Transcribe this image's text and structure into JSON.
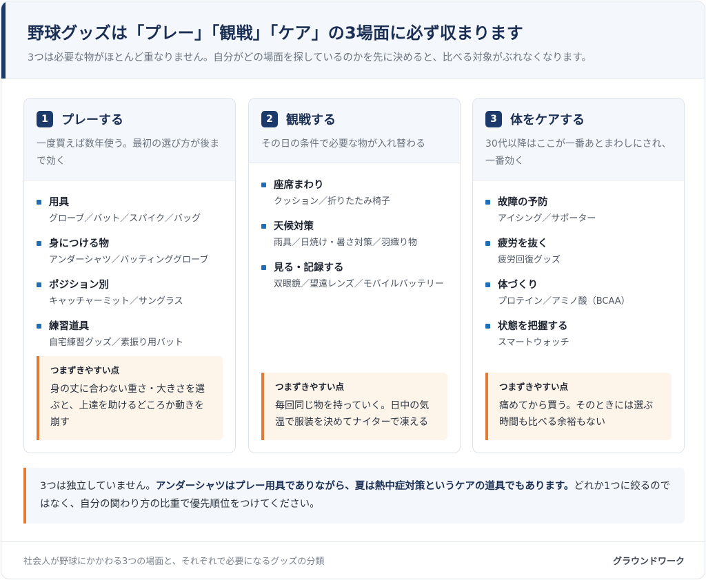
{
  "header": {
    "title": "野球グッズは「プレー」「観戦」「ケア」の3場面に必ず収まります",
    "subtitle": "3つは必要な物がほとんど重なりません。自分がどの場面を探しているのかを先に決めると、比べる対象がぶれなくなります。"
  },
  "columns": [
    {
      "number": "1",
      "title": "プレーする",
      "description": "一度買えば数年使う。最初の選び方が後まで効く",
      "items": [
        {
          "name": "用具",
          "detail": "グローブ／バット／スパイク／バッグ"
        },
        {
          "name": "身につける物",
          "detail": "アンダーシャツ／バッティンググローブ"
        },
        {
          "name": "ポジション別",
          "detail": "キャッチャーミット／サングラス"
        },
        {
          "name": "練習道具",
          "detail": "自宅練習グッズ／素振り用バット"
        }
      ],
      "warning_label": "つまずきやすい点",
      "warning_text": "身の丈に合わない重さ・大きさを選ぶと、上達を助けるどころか動きを崩す"
    },
    {
      "number": "2",
      "title": "観戦する",
      "description": "その日の条件で必要な物が入れ替わる",
      "items": [
        {
          "name": "座席まわり",
          "detail": "クッション／折りたたみ椅子"
        },
        {
          "name": "天候対策",
          "detail": "雨具／日焼け・暑さ対策／羽織り物"
        },
        {
          "name": "見る・記録する",
          "detail": "双眼鏡／望遠レンズ／モバイルバッテリー"
        }
      ],
      "warning_label": "つまずきやすい点",
      "warning_text": "毎回同じ物を持っていく。日中の気温で服装を決めてナイターで凍える"
    },
    {
      "number": "3",
      "title": "体をケアする",
      "description": "30代以降はここが一番あとまわしにされ、一番効く",
      "items": [
        {
          "name": "故障の予防",
          "detail": "アイシング／サポーター"
        },
        {
          "name": "疲労を抜く",
          "detail": "疲労回復グッズ"
        },
        {
          "name": "体づくり",
          "detail": "プロテイン／アミノ酸（BCAA）"
        },
        {
          "name": "状態を把握する",
          "detail": "スマートウォッチ"
        }
      ],
      "warning_label": "つまずきやすい点",
      "warning_text": "痛めてから買う。そのときには選ぶ時間も比べる余裕もない"
    }
  ],
  "note": {
    "lead": "3つは独立していません。",
    "emphasis": "アンダーシャツはプレー用具でありながら、夏は熱中症対策というケアの道具でもあります。",
    "tail": "どれか1つに絞るのではなく、自分の関わり方の比重で優先順位をつけてください。"
  },
  "footer": {
    "caption": "社会人が野球にかかわる3つの場面と、それぞれで必要になるグッズの分類",
    "brand": "グラウンドワーク"
  },
  "colors": {
    "navy": "#1b3a6b",
    "bullet_blue": "#1f6fb8",
    "warning_orange": "#e07b35",
    "warning_bg": "#fdf4ea",
    "panel_bg": "#f4f7fb"
  }
}
